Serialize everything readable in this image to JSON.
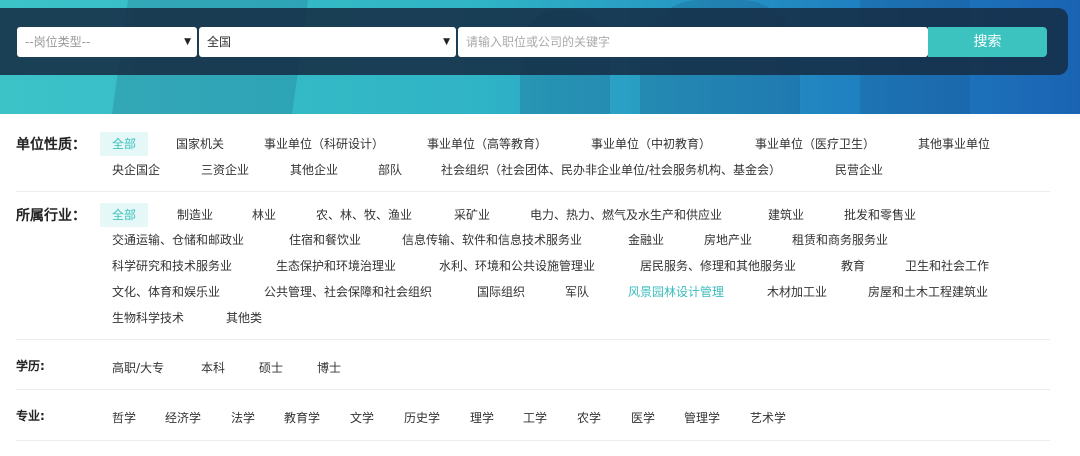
{
  "search": {
    "job_type": "--岗位类型--",
    "region": "全国",
    "keyword_placeholder": "请输入职位或公司的关键字",
    "button": "搜索"
  },
  "filters": {
    "unit": {
      "label": "单位性质：",
      "options": [
        "全部",
        "国家机关",
        "事业单位（科研设计）",
        "事业单位（高等教育）",
        "事业单位（中初教育）",
        "事业单位（医疗卫生）",
        "其他事业单位",
        "央企国企",
        "三资企业",
        "其他企业",
        "部队",
        "社会组织（社会团体、民办非企业单位/社会服务机构、基金会）",
        "民营企业"
      ]
    },
    "industry": {
      "label": "所属行业：",
      "options": [
        "全部",
        "制造业",
        "林业",
        "农、林、牧、渔业",
        "采矿业",
        "电力、热力、燃气及水生产和供应业",
        "建筑业",
        "批发和零售业",
        "交通运输、仓储和邮政业",
        "住宿和餐饮业",
        "信息传输、软件和信息技术服务业",
        "金融业",
        "房地产业",
        "租赁和商务服务业",
        "科学研究和技术服务业",
        "生态保护和环境治理业",
        "水利、环境和公共设施管理业",
        "居民服务、修理和其他服务业",
        "教育",
        "卫生和社会工作",
        "文化、体育和娱乐业",
        "公共管理、社会保障和社会组织",
        "国际组织",
        "军队",
        "风景园林设计管理",
        "木材加工业",
        "房屋和土木工程建筑业",
        "生物科学技术",
        "其他类"
      ]
    },
    "education": {
      "label": "学历:",
      "options": [
        "高职/大专",
        "本科",
        "硕士",
        "博士"
      ]
    },
    "major": {
      "label": "专业:",
      "options": [
        "哲学",
        "经济学",
        "法学",
        "教育学",
        "文学",
        "历史学",
        "理学",
        "工学",
        "农学",
        "医学",
        "管理学",
        "艺术学"
      ]
    }
  },
  "colors": {
    "accent": "#3cc3c0",
    "panel": "#162d46"
  }
}
